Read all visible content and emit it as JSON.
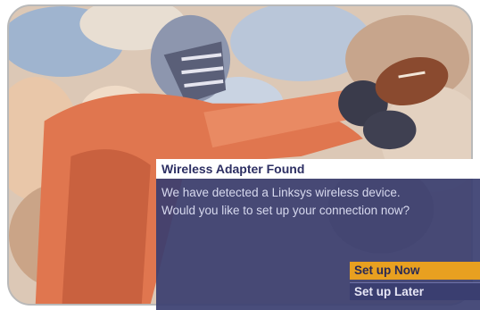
{
  "dialog": {
    "title": "Wireless Adapter Found",
    "message_line1": "We have detected a Linksys wireless device.",
    "message_line2": "Would you like to set up your connection now?"
  },
  "options": [
    {
      "label": "Set up Now",
      "selected": true
    },
    {
      "label": "Set up Later",
      "selected": false
    }
  ],
  "colors": {
    "dialog_bg": "#3a3e70",
    "highlight": "#e8a020",
    "title_text": "#2d2f63"
  }
}
